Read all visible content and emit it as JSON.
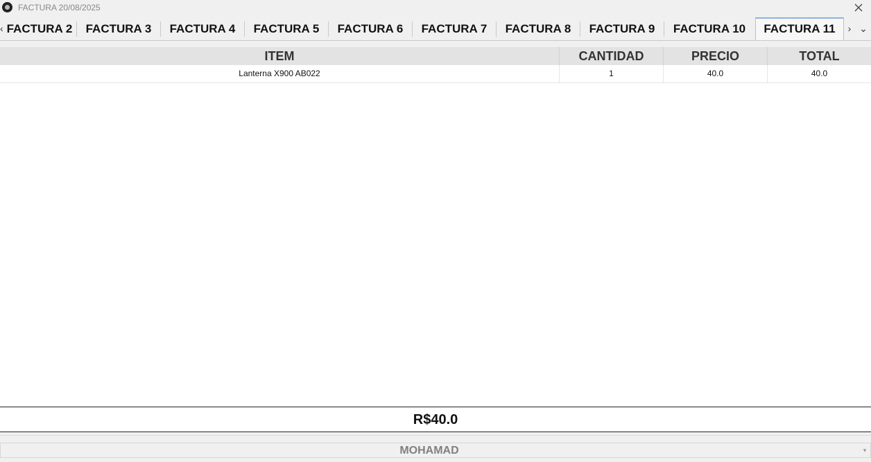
{
  "window": {
    "title": "FACTURA 20/08/2025",
    "close_icon": "close-icon",
    "app_icon": "app-logo-icon"
  },
  "tabs": [
    {
      "label": "FACTURA 2"
    },
    {
      "label": "FACTURA 3"
    },
    {
      "label": "FACTURA 4"
    },
    {
      "label": "FACTURA 5"
    },
    {
      "label": "FACTURA 6"
    },
    {
      "label": "FACTURA 7"
    },
    {
      "label": "FACTURA 8"
    },
    {
      "label": "FACTURA 9"
    },
    {
      "label": "FACTURA 10"
    },
    {
      "label": "FACTURA 11"
    }
  ],
  "selected_tab": "FACTURA 11",
  "tab_controls": {
    "scroll_left_glyph": "‹",
    "scroll_right_glyph": "›",
    "menu_glyph": "⌄"
  },
  "table": {
    "headers": {
      "item": "ITEM",
      "cantidad": "CANTIDAD",
      "precio": "PRECIO",
      "total": "TOTAL"
    },
    "rows": [
      {
        "item": "Lanterna X900 AB022",
        "cantidad": "1",
        "precio": "40.0",
        "total": "40.0"
      }
    ]
  },
  "total_label": "R$40.0",
  "seller_select": {
    "value": "MOHAMAD",
    "arrow_glyph": "▾"
  },
  "colors": {
    "selected_tab_accent": "#8fb3d9",
    "header_bg": "#e3e3e3",
    "combo_text": "#808080"
  }
}
